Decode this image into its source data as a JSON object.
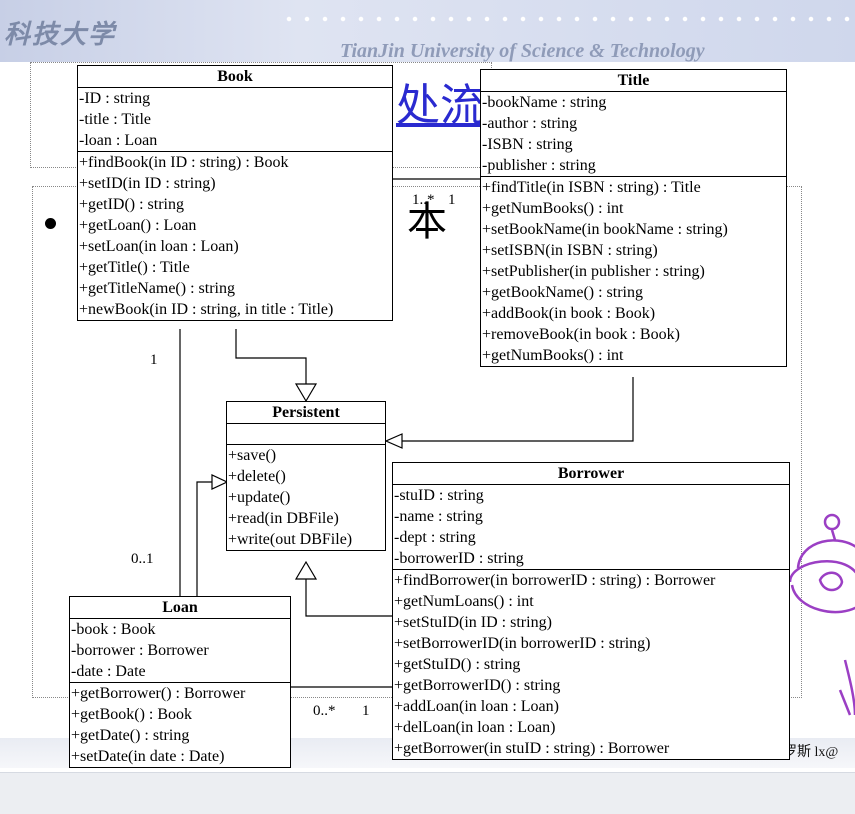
{
  "slide": {
    "logo_cn": "科技大学",
    "logo_en": "TianJin University of Science & Technology",
    "bg_title": "处流",
    "bg_char": "本",
    "author_text": "罗斯 lx@"
  },
  "classes": {
    "book": {
      "name": "Book",
      "attributes": [
        "-ID : string",
        "-title : Title",
        "-loan : Loan"
      ],
      "operations": [
        "+findBook(in ID : string) : Book",
        "+setID(in ID : string)",
        "+getID() : string",
        "+getLoan() : Loan",
        "+setLoan(in loan : Loan)",
        "+getTitle() : Title",
        "+getTitleName() : string",
        "+newBook(in ID : string, in title : Title)"
      ]
    },
    "title": {
      "name": "Title",
      "attributes": [
        "-bookName : string",
        "-author : string",
        "-ISBN : string",
        "-publisher : string"
      ],
      "operations": [
        "+findTitle(in ISBN : string) : Title",
        "+getNumBooks() : int",
        "+setBookName(in bookName : string)",
        "+setISBN(in ISBN : string)",
        "+setPublisher(in publisher : string)",
        "+getBookName() : string",
        "+addBook(in book : Book)",
        "+removeBook(in book : Book)",
        "+getNumBooks() : int"
      ]
    },
    "persistent": {
      "name": "Persistent",
      "attributes": [],
      "operations": [
        "+save()",
        "+delete()",
        "+update()",
        "+read(in DBFile)",
        "+write(out DBFile)"
      ]
    },
    "borrower": {
      "name": "Borrower",
      "attributes": [
        "-stuID : string",
        "-name : string",
        "-dept : string",
        "-borrowerID : string"
      ],
      "operations": [
        "+findBorrower(in borrowerID : string) : Borrower",
        "+getNumLoans() : int",
        "+setStuID(in ID : string)",
        "+setBorrowerID(in borrowerID : string)",
        "+getStuID() : string",
        "+getBorrowerID() : string",
        "+addLoan(in loan : Loan)",
        "+delLoan(in loan : Loan)",
        "+getBorrower(in stuID : string) : Borrower"
      ]
    },
    "loan": {
      "name": "Loan",
      "attributes": [
        "-book : Book",
        "-borrower : Borrower",
        "-date : Date"
      ],
      "operations": [
        "+getBorrower() : Borrower",
        "+getBook() : Book",
        "+getDate() : string",
        "+setDate(in date : Date)"
      ]
    }
  },
  "multiplicities": {
    "book_title_many": "1..*",
    "book_title_one": "1",
    "book_loan_one": "1",
    "book_loan_opt": "0..1",
    "loan_borrower_many": "0..*",
    "loan_borrower_one": "1"
  }
}
